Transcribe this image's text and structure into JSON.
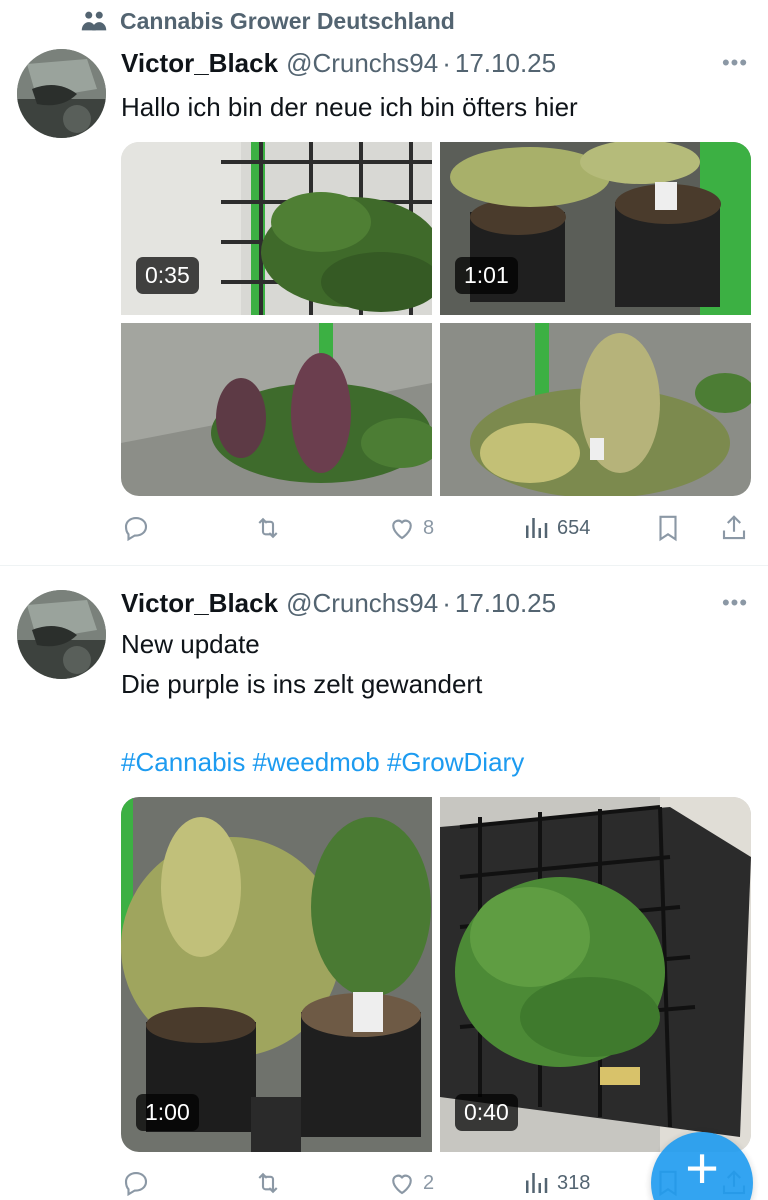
{
  "community": {
    "name": "Cannabis Grower Deutschland",
    "icon": "community-icon"
  },
  "tweets": [
    {
      "display_name": "Victor_Black",
      "handle": "@Crunchs94",
      "separator": "·",
      "date": "17.10.25",
      "text_lines": [
        "Hallo ich bin der neue ich bin öfters hier"
      ],
      "hashtags": "",
      "media": [
        {
          "duration": "0:35"
        },
        {
          "duration": "1:01"
        },
        {
          "duration": ""
        },
        {
          "duration": ""
        }
      ],
      "stats": {
        "likes": "8",
        "views": "654"
      }
    },
    {
      "display_name": "Victor_Black",
      "handle": "@Crunchs94",
      "separator": "·",
      "date": "17.10.25",
      "text_lines": [
        "New update",
        "Die purple is ins zelt gewandert"
      ],
      "hashtags": "#Cannabis #weedmob #GrowDiary",
      "media": [
        {
          "duration": "1:00"
        },
        {
          "duration": "0:40"
        }
      ],
      "stats": {
        "likes": "2",
        "views": "318"
      }
    }
  ],
  "fab": {
    "label": "+"
  },
  "colors": {
    "accent": "#1d9bf0",
    "muted": "#536471",
    "text": "#0f1419",
    "icon": "#8b98a5"
  }
}
